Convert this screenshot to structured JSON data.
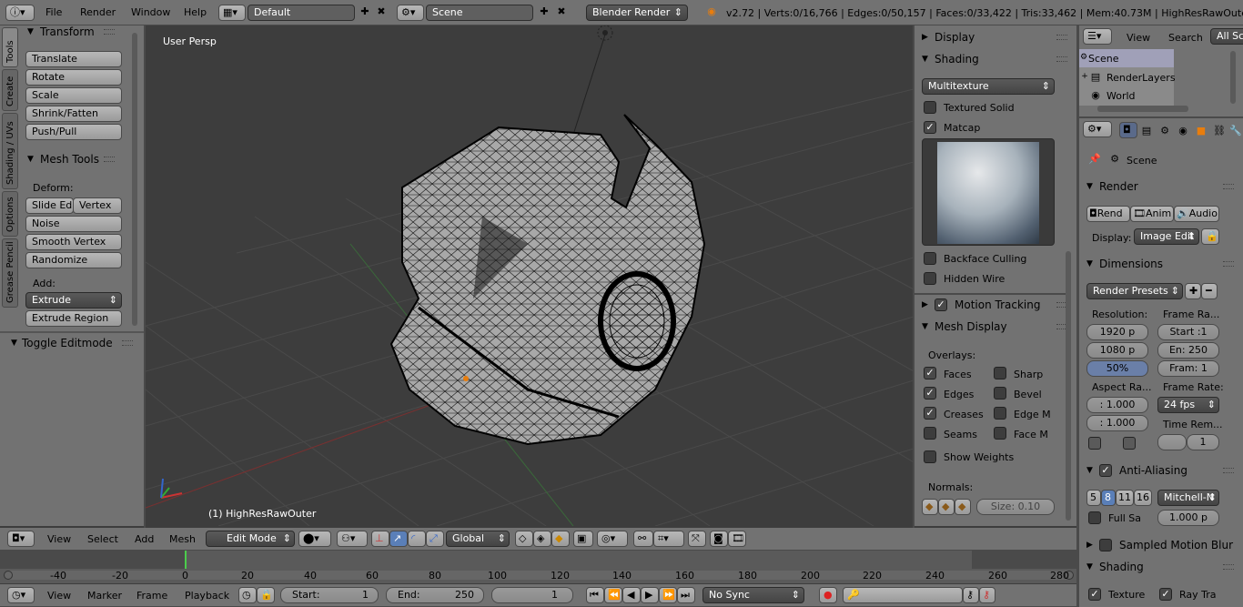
{
  "topbar": {
    "menus": [
      "File",
      "Render",
      "Window",
      "Help"
    ],
    "layout": "Default",
    "scene": "Scene",
    "engine": "Blender Render",
    "stats": "v2.72 | Verts:0/16,766 | Edges:0/50,157 | Faces:0/33,422 | Tris:33,462 | Mem:40.73M | HighResRawOuter"
  },
  "tools": {
    "tabs": [
      "Tools",
      "Create",
      "Shading / UVs",
      "Options",
      "Grease Pencil"
    ],
    "transform_title": "Transform",
    "transform_buttons": [
      "Translate",
      "Rotate",
      "Scale",
      "Shrink/Fatten",
      "Push/Pull"
    ],
    "mesh_tools_title": "Mesh Tools",
    "deform_label": "Deform:",
    "slide_edge": "Slide Ed",
    "vertex": "Vertex",
    "deform_buttons": [
      "Noise",
      "Smooth Vertex",
      "Randomize"
    ],
    "add_label": "Add:",
    "extrude": "Extrude",
    "extrude_region": "Extrude Region",
    "toggle_editmode": "Toggle Editmode"
  },
  "viewport": {
    "view_label": "User Persp",
    "object_label": "(1) HighResRawOuter"
  },
  "properties": {
    "display": "Display",
    "shading": "Shading",
    "shading_mode": "Multitexture",
    "textured_solid": "Textured Solid",
    "matcap": "Matcap",
    "backface_culling": "Backface Culling",
    "hidden_wire": "Hidden Wire",
    "motion_tracking": "Motion Tracking",
    "mesh_display": "Mesh Display",
    "overlays": "Overlays:",
    "faces": "Faces",
    "sharp": "Sharp",
    "edges": "Edges",
    "bevel": "Bevel",
    "creases": "Creases",
    "edge_m": "Edge M",
    "seams": "Seams",
    "face_m": "Face M",
    "show_weights": "Show Weights",
    "normals": "Normals:",
    "size": "Size:  0.10"
  },
  "outliner": {
    "view": "View",
    "search": "Search",
    "all_scenes": "All Sc",
    "items": [
      "Scene",
      "RenderLayers",
      "World"
    ]
  },
  "render": {
    "scene": "Scene",
    "render_title": "Render",
    "rend": "Rend",
    "anim": "Anim",
    "audio": "Audio",
    "display_label": "Display:",
    "display_value": "Image Edit",
    "dimensions": "Dimensions",
    "render_presets": "Render Presets",
    "resolution": "Resolution:",
    "res_x": "1920 p",
    "res_y": "1080 p",
    "res_pct": "50%",
    "frame_range": "Frame Ra...",
    "start": "Start :1",
    "end": "En: 250",
    "frame": "Fram: 1",
    "aspect": "Aspect Ra...",
    "aspect_x": ": 1.000",
    "aspect_y": ": 1.000",
    "frame_rate": "Frame Rate:",
    "fps": "24 fps",
    "time_remap": "Time Rem...",
    "remap_val": "1",
    "anti_aliasing": "Anti-Aliasing",
    "aa_samples": [
      "5",
      "8",
      "11",
      "16"
    ],
    "filter": "Mitchell-N",
    "full_sample": "Full Sa",
    "filter_size": "1.000 p",
    "motion_blur": "Sampled Motion Blur",
    "shading": "Shading",
    "texture": "Texture",
    "ray_trace": "Ray Tra"
  },
  "view3d_header": {
    "view": "View",
    "select": "Select",
    "add": "Add",
    "mesh": "Mesh",
    "mode": "Edit Mode",
    "orientation": "Global"
  },
  "timeline": {
    "ticks": [
      "-40",
      "-20",
      "0",
      "20",
      "40",
      "60",
      "80",
      "100",
      "120",
      "140",
      "160",
      "180",
      "200",
      "220",
      "240",
      "260",
      "280"
    ],
    "view": "View",
    "marker": "Marker",
    "frame": "Frame",
    "playback": "Playback",
    "start": "Start:",
    "start_val": "1",
    "end": "End:",
    "end_val": "250",
    "current": "1",
    "sync": "No Sync"
  }
}
